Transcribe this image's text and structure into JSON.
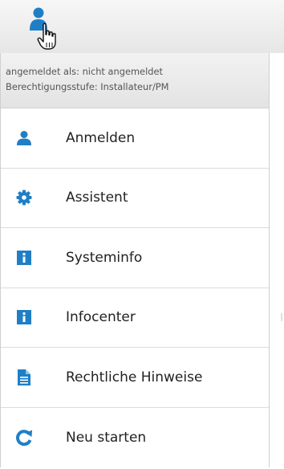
{
  "header": {
    "user_icon": "user-icon",
    "cursor_icon": "hand-pointer-icon"
  },
  "info": {
    "logged_in_as": "angemeldet als: nicht angemeldet",
    "permission_level": "Berechtigungsstufe: Installateur/PM"
  },
  "menu": {
    "items": [
      {
        "label": "Anmelden",
        "icon": "user-icon"
      },
      {
        "label": "Assistent",
        "icon": "gear-icon"
      },
      {
        "label": "Systeminfo",
        "icon": "info-icon"
      },
      {
        "label": "Infocenter",
        "icon": "info-icon"
      },
      {
        "label": "Rechtliche Hinweise",
        "icon": "document-icon"
      },
      {
        "label": "Neu starten",
        "icon": "refresh-icon"
      }
    ]
  },
  "colors": {
    "accent_blue": "#1f7fc6",
    "text": "#222222",
    "info_text": "#555555"
  }
}
